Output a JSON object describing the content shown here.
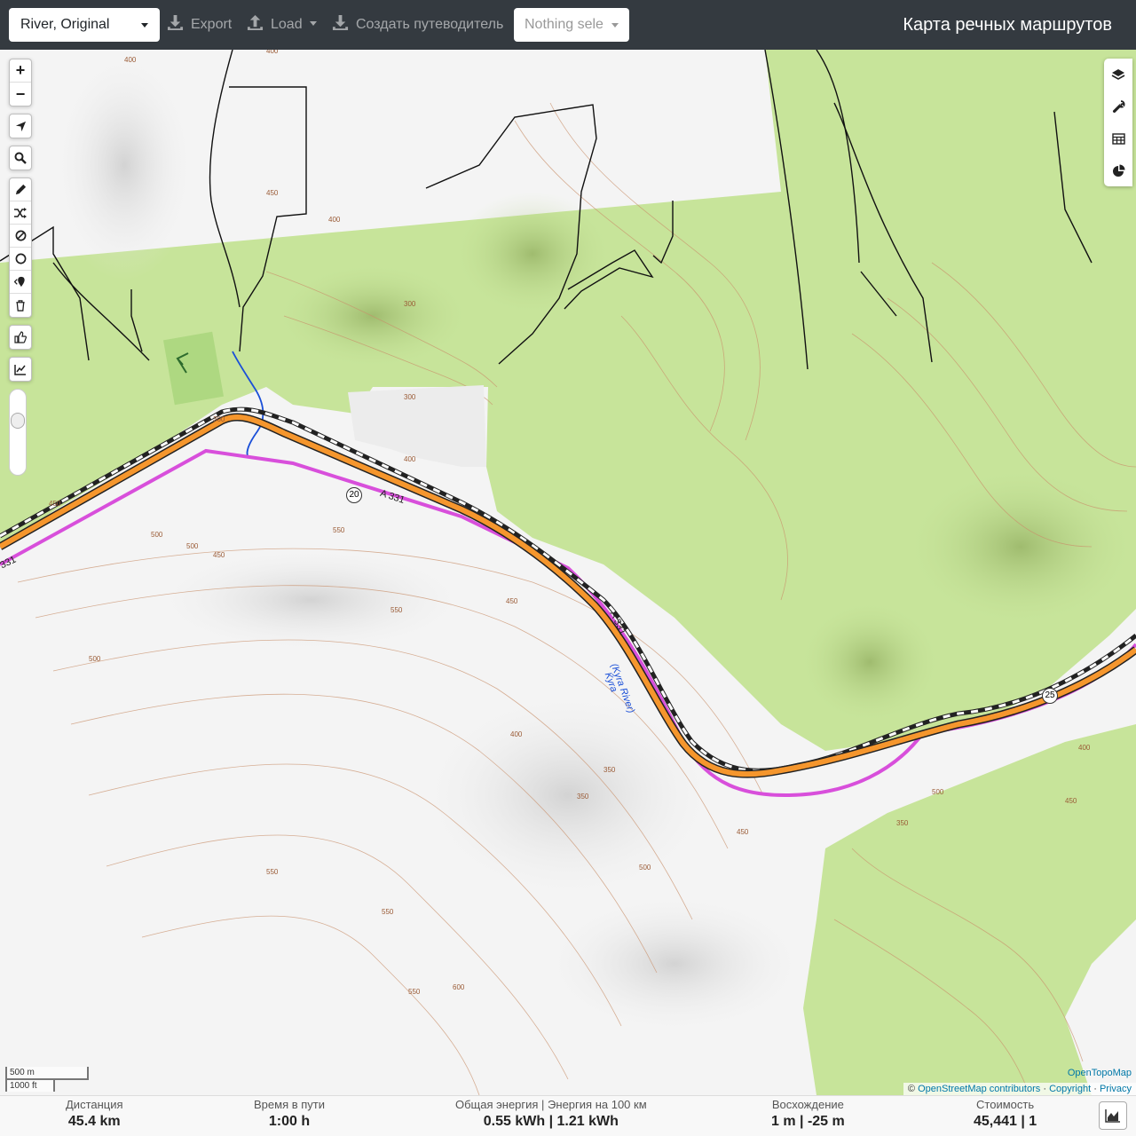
{
  "navbar": {
    "profile": "River, Original",
    "export_label": "Export",
    "load_label": "Load",
    "guide_label": "Создать путеводитель",
    "routes_placeholder": "Nothing sele",
    "brand": "Карта речных маршрутов"
  },
  "map": {
    "labels": {
      "road_a331_1": "A 331",
      "road_a331_2": "A 331",
      "road_a331_3": "331",
      "shield_20": "20",
      "shield_25": "25",
      "river_name": "Kyra",
      "river_name_en": "(Kyra River)"
    },
    "contours": [
      "500",
      "400",
      "400",
      "500",
      "450",
      "400",
      "300",
      "300",
      "300",
      "400",
      "450",
      "500",
      "500",
      "450",
      "550",
      "550",
      "500",
      "450",
      "400",
      "350",
      "350",
      "450",
      "500",
      "550",
      "550",
      "600",
      "550",
      "500",
      "450",
      "400",
      "350"
    ],
    "scale": {
      "metric": "500 m",
      "imperial": "1000 ft"
    },
    "attribution": {
      "opentopo": "OpenTopoMap",
      "copy": "©",
      "osm": "OpenStreetMap contributors",
      "sep": "·",
      "copyright": "Copyright",
      "privacy": "Privacy"
    }
  },
  "stats": {
    "distance_label": "Дистанция",
    "distance_value": "45.4 km",
    "time_label": "Время в пути",
    "time_value": "1:00 h",
    "energy_label": "Общая энергия | Энергия на 100 км",
    "energy_value": "0.55 kWh | 1.21 kWh",
    "ascent_label": "Восхождение",
    "ascent_value": "1 m | -25 m",
    "cost_label": "Стоимость",
    "cost_value": "45,441 | 1"
  },
  "colors": {
    "navbar": "#343a40",
    "forest": "#c7e49a",
    "route": "#d84fdb",
    "road": "#f5962d",
    "river": "#1a4fd8"
  }
}
